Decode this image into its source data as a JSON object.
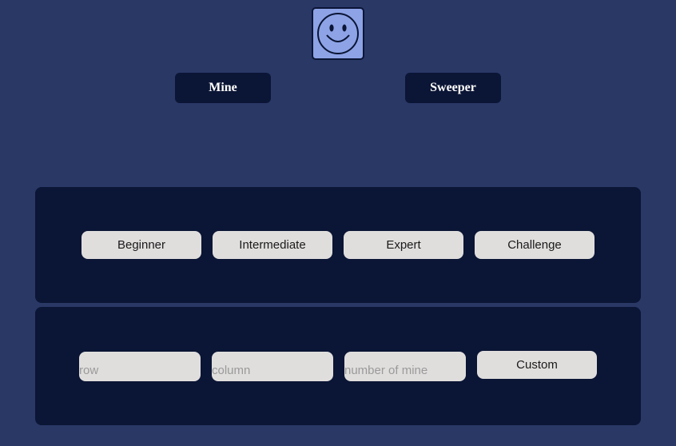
{
  "header": {
    "smiley_icon": "smiley-face-icon",
    "left_label": "Mine",
    "right_label": "Sweeper"
  },
  "difficulty": {
    "beginner": "Beginner",
    "intermediate": "Intermediate",
    "expert": "Expert",
    "challenge": "Challenge"
  },
  "custom": {
    "row_placeholder": "row",
    "column_placeholder": "column",
    "mines_placeholder": "number of mine",
    "button_label": "Custom"
  },
  "colors": {
    "background": "#2a3866",
    "panel": "#0b1535",
    "smiley_fill": "#8da3e6",
    "button_fill": "#e0dedd"
  }
}
